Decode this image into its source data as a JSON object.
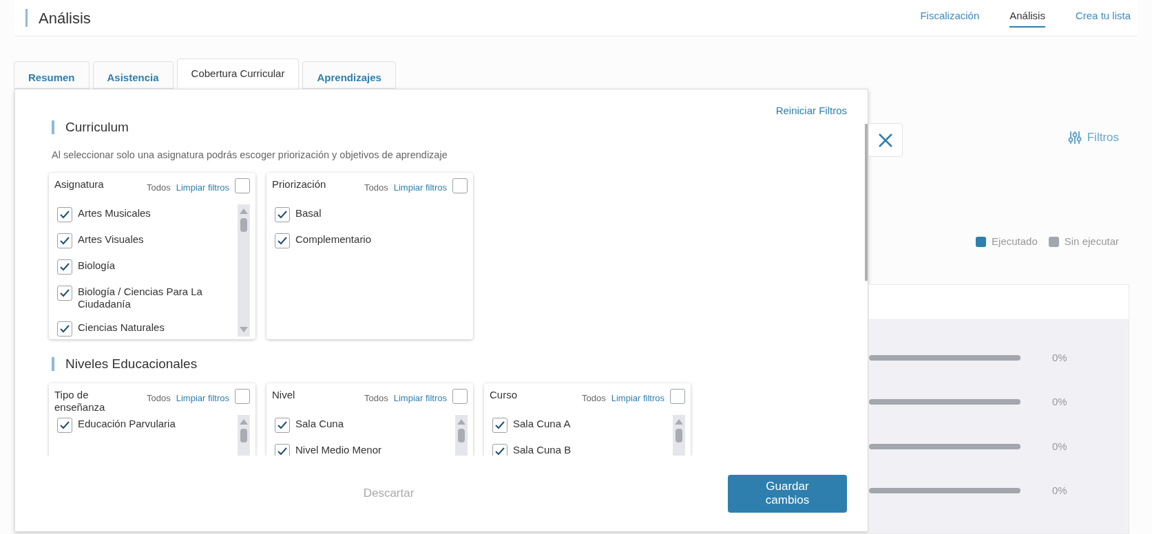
{
  "header": {
    "title": "Análisis",
    "nav": [
      {
        "label": "Fiscalización",
        "selected": false
      },
      {
        "label": "Análisis",
        "selected": true
      },
      {
        "label": "Crea tu lista",
        "selected": false
      }
    ]
  },
  "tabs": [
    {
      "label": "Resumen",
      "selected": false
    },
    {
      "label": "Asistencia",
      "selected": false
    },
    {
      "label": "Cobertura Curricular",
      "selected": true
    },
    {
      "label": "Aprendizajes",
      "selected": false
    }
  ],
  "filter_panel": {
    "reset_link": "Reiniciar Filtros",
    "sections": [
      {
        "title": "Curriculum",
        "description": "Al seleccionar solo una asignatura podrás escoger priorización y objetivos de aprendizaje",
        "groups": [
          {
            "title": "Asignatura",
            "all_label": "Todos",
            "clear_label": "Limpiar filtros",
            "all_checked": false,
            "scrollable": true,
            "items": [
              {
                "label": "Artes Musicales",
                "checked": true
              },
              {
                "label": "Artes Visuales",
                "checked": true
              },
              {
                "label": "Biología",
                "checked": true
              },
              {
                "label": "Biología / Ciencias Para La Ciudadanía",
                "checked": true
              },
              {
                "label": "Ciencias Naturales",
                "checked": true
              }
            ]
          },
          {
            "title": "Priorización",
            "all_label": "Todos",
            "clear_label": "Limpiar filtros",
            "all_checked": false,
            "scrollable": false,
            "items": [
              {
                "label": "Basal",
                "checked": true
              },
              {
                "label": "Complementario",
                "checked": true
              }
            ]
          }
        ]
      },
      {
        "title": "Niveles Educacionales",
        "groups": [
          {
            "title": "Tipo de enseñanza",
            "all_label": "Todos",
            "clear_label": "Limpiar filtros",
            "all_checked": false,
            "scrollable": true,
            "items": [
              {
                "label": "Educación Parvularia",
                "checked": true
              }
            ]
          },
          {
            "title": "Nivel",
            "all_label": "Todos",
            "clear_label": "Limpiar filtros",
            "all_checked": false,
            "scrollable": true,
            "items": [
              {
                "label": "Sala Cuna",
                "checked": true
              },
              {
                "label": "Nivel Medio Menor",
                "checked": true
              }
            ]
          },
          {
            "title": "Curso",
            "all_label": "Todos",
            "clear_label": "Limpiar filtros",
            "all_checked": false,
            "scrollable": true,
            "items": [
              {
                "label": "Sala Cuna A",
                "checked": true
              },
              {
                "label": "Sala Cuna B",
                "checked": true
              }
            ]
          }
        ]
      }
    ],
    "discard": "Descartar",
    "save": "Guardar cambios"
  },
  "background": {
    "filters_button": "Filtros",
    "legend": [
      {
        "label": "Ejecutado",
        "color": "#2e7fad"
      },
      {
        "label": "Sin ejecutar",
        "color": "#a3a7ad"
      }
    ],
    "rows": [
      {
        "reading": "0%"
      },
      {
        "reading": "0%"
      },
      {
        "reading": "0%"
      },
      {
        "reading": "0%"
      }
    ]
  }
}
